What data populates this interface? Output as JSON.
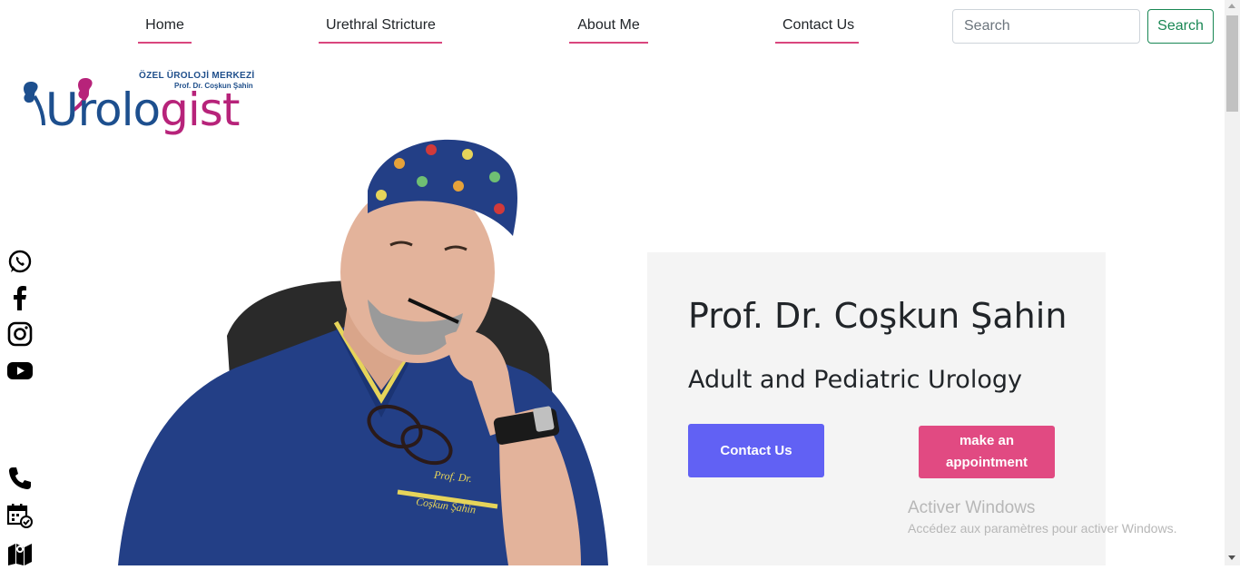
{
  "nav": {
    "items": [
      {
        "label": "Home"
      },
      {
        "label": "Urethral Stricture"
      },
      {
        "label": "About Me"
      },
      {
        "label": "Contact Us"
      }
    ],
    "search": {
      "placeholder": "Search",
      "button_label": "Search"
    }
  },
  "logo": {
    "line1": "ÖZEL ÜROLOJİ MERKEZİ",
    "line2": "Prof. Dr. Coşkun Şahin",
    "word_part1": "Urolo",
    "word_part2": "gist"
  },
  "photo": {
    "name_badge_line1": "Prof. Dr.",
    "name_badge_line2": "Coşkun Şahin"
  },
  "hero": {
    "name": "Prof. Dr. Coşkun Şahin",
    "subtitle": "Adult and Pediatric Urology",
    "contact_button": "Contact Us",
    "appointment_button": "make an appointment"
  },
  "social_icons": [
    "whatsapp-icon",
    "facebook-icon",
    "instagram-icon",
    "youtube-icon"
  ],
  "contact_icons": [
    "phone-icon",
    "calendar-icon",
    "map-icon"
  ],
  "colors": {
    "accent_pink": "#e14a82",
    "accent_purple": "#6161f4",
    "search_green": "#198754",
    "logo_blue": "#1d4f8e",
    "logo_magenta": "#b7237a"
  },
  "watermark": {
    "title": "Activer Windows",
    "subtitle": "Accédez aux paramètres pour activer Windows."
  }
}
